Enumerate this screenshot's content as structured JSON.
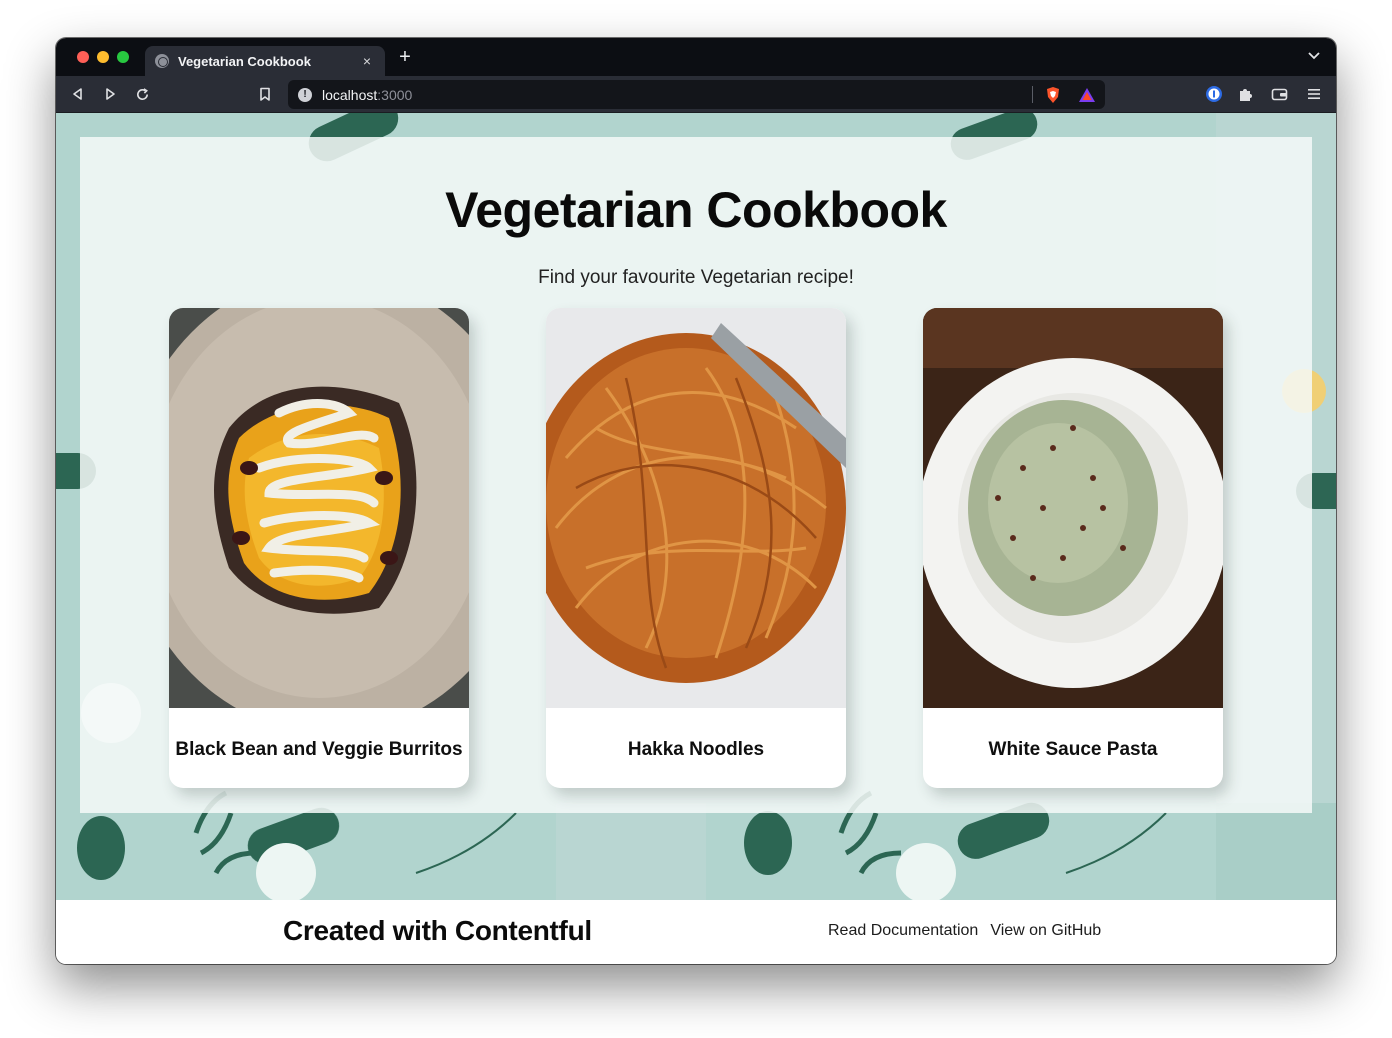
{
  "browser": {
    "tab_title": "Vegetarian Cookbook",
    "tab_close": "×",
    "new_tab": "+",
    "url_host": "localhost",
    "url_port": ":3000"
  },
  "page": {
    "heading": "Vegetarian Cookbook",
    "subheading": "Find your favourite Vegetarian recipe!",
    "recipes": [
      {
        "title": "Black Bean and Veggie Burritos",
        "image": "burrito-photo"
      },
      {
        "title": "Hakka Noodles",
        "image": "noodles-photo"
      },
      {
        "title": "White Sauce Pasta",
        "image": "pasta-photo"
      }
    ]
  },
  "footer": {
    "brand": "Created with Contentful",
    "links": [
      "Read Documentation",
      "View on GitHub"
    ]
  },
  "colors": {
    "page_bg": "#b1d4ce",
    "panel_bg": "#f4f9f8",
    "browser_chrome": "#2a2d36",
    "tabstrip": "#0c0e13"
  }
}
